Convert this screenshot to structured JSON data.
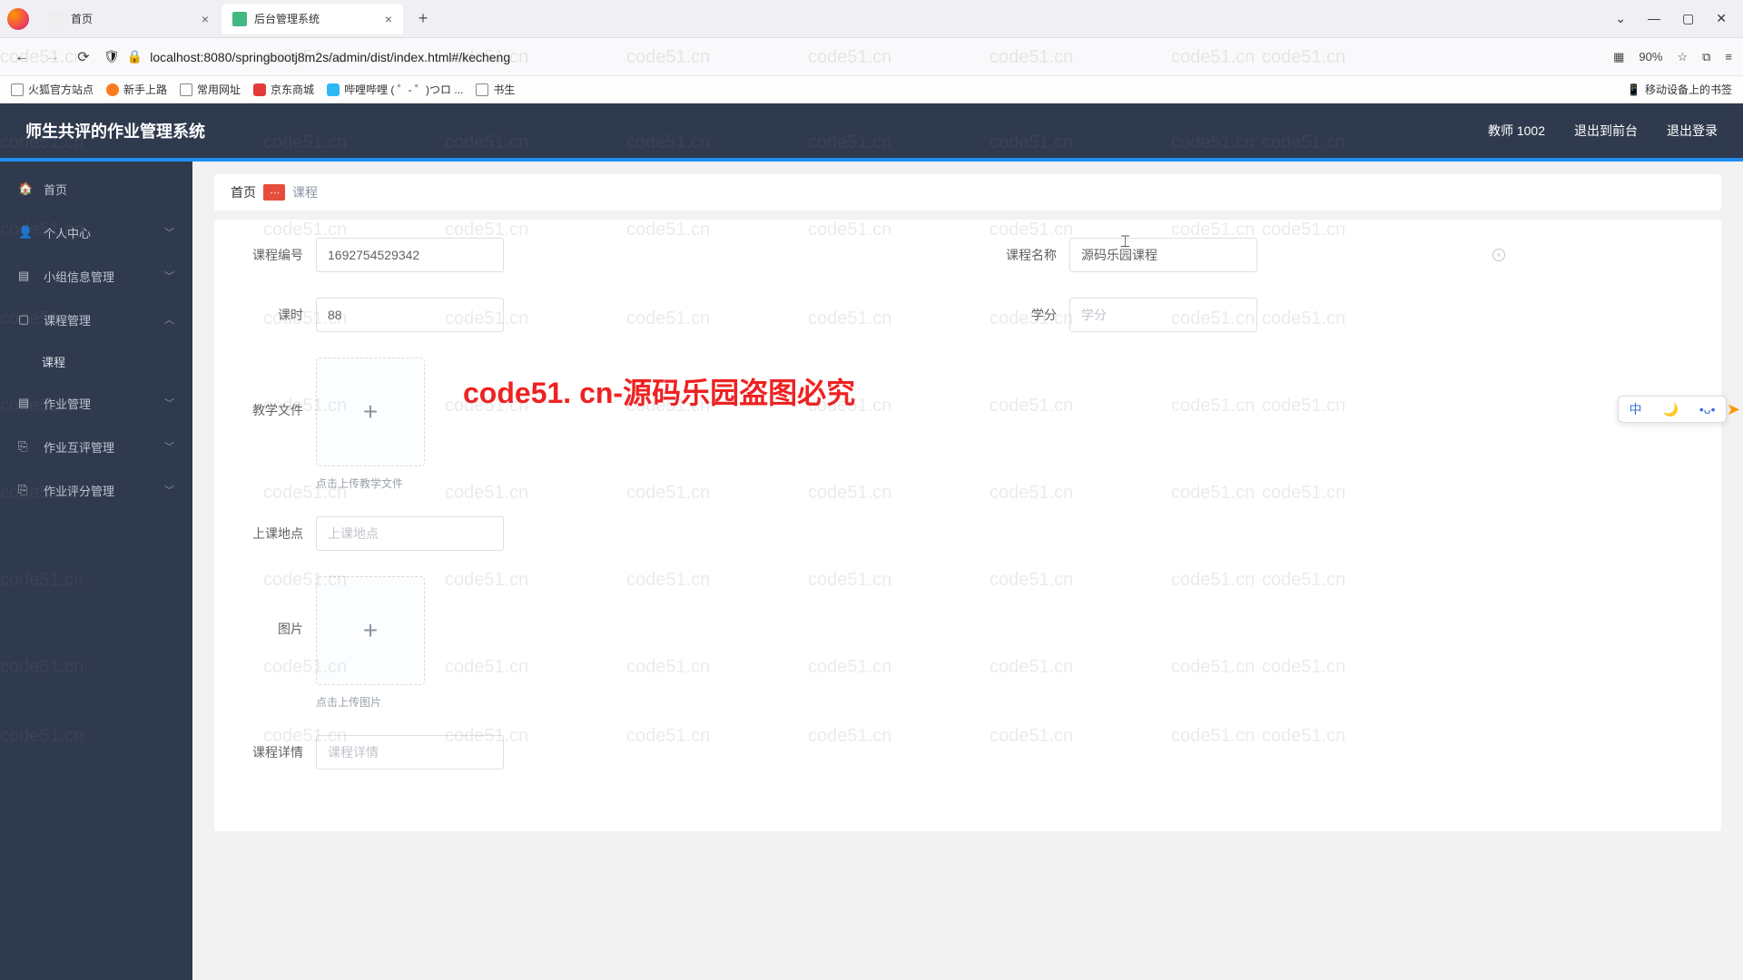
{
  "browser": {
    "tabs": [
      {
        "title": "首页",
        "active": false
      },
      {
        "title": "后台管理系统",
        "active": true
      }
    ],
    "url": "localhost:8080/springbootj8m2s/admin/dist/index.html#/kecheng",
    "zoom": "90%",
    "bookmarks": [
      "火狐官方站点",
      "新手上路",
      "常用网址",
      "京东商城",
      "哔哩哔哩 ( ゜- ゜)つロ ...",
      "书生"
    ],
    "mobile_bookmark": "移动设备上的书签"
  },
  "app": {
    "title": "师生共评的作业管理系统",
    "header_links": [
      "教师 1002",
      "退出到前台",
      "退出登录"
    ]
  },
  "sidebar": {
    "items": [
      {
        "label": "首页",
        "expandable": false
      },
      {
        "label": "个人中心",
        "expandable": true
      },
      {
        "label": "小组信息管理",
        "expandable": true
      },
      {
        "label": "课程管理",
        "expandable": true,
        "expanded": true,
        "children": [
          "课程"
        ]
      },
      {
        "label": "作业管理",
        "expandable": true
      },
      {
        "label": "作业互评管理",
        "expandable": true
      },
      {
        "label": "作业评分管理",
        "expandable": true
      }
    ]
  },
  "breadcrumb": {
    "home": "首页",
    "current": "课程"
  },
  "form": {
    "course_no": {
      "label": "课程编号",
      "value": "1692754529342"
    },
    "course_name": {
      "label": "课程名称",
      "value": "源码乐园课程"
    },
    "hours": {
      "label": "课时",
      "value": "88"
    },
    "credit": {
      "label": "学分",
      "value": "",
      "placeholder": "学分"
    },
    "file": {
      "label": "教学文件",
      "hint": "点击上传教学文件"
    },
    "location": {
      "label": "上课地点",
      "value": "",
      "placeholder": "上课地点"
    },
    "image": {
      "label": "图片",
      "hint": "点击上传图片"
    },
    "detail": {
      "label": "课程详情",
      "value": "",
      "placeholder": "课程详情"
    }
  },
  "watermark": {
    "text": "code51.cn",
    "big": "code51. cn-源码乐园盗图必究"
  },
  "ime": {
    "lang": "中",
    "moon": "🌙",
    "mode": "•ᴗ•"
  }
}
